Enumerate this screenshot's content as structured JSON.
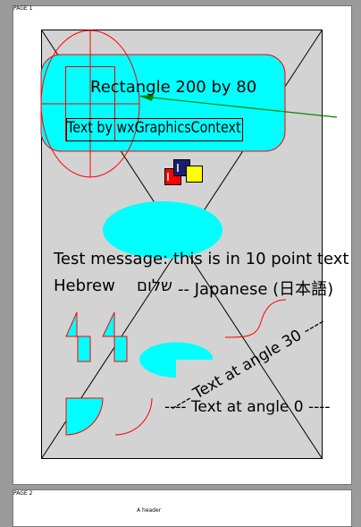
{
  "preview": {
    "page1_label": "PAGE 1",
    "page2_label": "PAGE 2",
    "page2_header": "A header"
  },
  "drawing": {
    "rect_text": "Rectangle 200 by 80",
    "gc_text": "Text by wxGraphicsContext",
    "test_message": "Test message: this is in 10 point text",
    "hebrew_line_prefix": "Hebrew",
    "hebrew_text": "שלום",
    "japanese_line_suffix": "-- Japanese (日本語)",
    "angle30_text": "---- Text at angle 30 ----",
    "angle0_text": "---- Text at angle 0 ----"
  },
  "colors": {
    "background": "#d3d3d3",
    "cyan": "#00ffff",
    "red": "#ff0000",
    "green": "#008000",
    "navy": "#1e1e6e",
    "yellow": "#ffff00"
  }
}
